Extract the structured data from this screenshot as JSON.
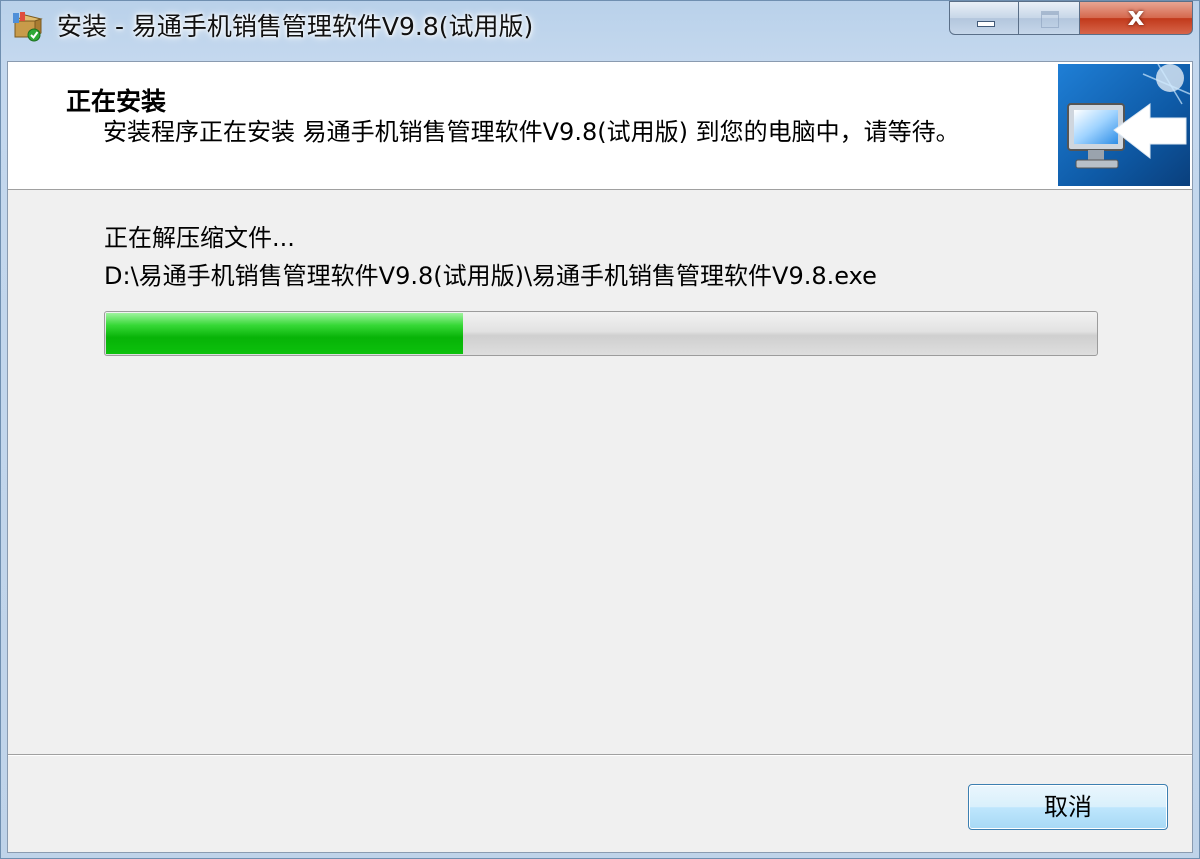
{
  "window": {
    "title": "安装 - 易通手机销售管理软件V9.8(试用版)",
    "close_glyph": "x"
  },
  "header": {
    "title": "正在安装",
    "description": "安装程序正在安装 易通手机销售管理软件V9.8(试用版) 到您的电脑中，请等待。"
  },
  "main": {
    "status": "正在解压缩文件...",
    "file_path": "D:\\易通手机销售管理软件V9.8(试用版)\\易通手机销售管理软件V9.8.exe",
    "progress_fraction": 0.36,
    "progress_color": "#07b307"
  },
  "footer": {
    "cancel_label": "取消"
  },
  "icons": {
    "app": "installer-box-icon",
    "header_image": "computer-install-icon"
  }
}
